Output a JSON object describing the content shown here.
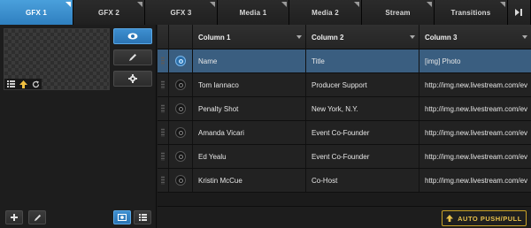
{
  "tabs": [
    {
      "label": "GFX 1",
      "active": true
    },
    {
      "label": "GFX 2",
      "active": false
    },
    {
      "label": "GFX 3",
      "active": false
    },
    {
      "label": "Media 1",
      "active": false
    },
    {
      "label": "Media 2",
      "active": false
    },
    {
      "label": "Stream",
      "active": false
    },
    {
      "label": "Transitions",
      "active": false
    }
  ],
  "tab_overflow_icon": "skip-next-icon",
  "preview": {
    "icons": [
      "list-icon",
      "arrow-up-icon",
      "refresh-icon"
    ]
  },
  "side_buttons": [
    {
      "icon": "eye-icon",
      "active": true
    },
    {
      "icon": "pencil-icon",
      "active": false
    },
    {
      "icon": "gear-icon",
      "active": false
    }
  ],
  "bottom_left_buttons": [
    {
      "icon": "plus-icon",
      "active": false
    },
    {
      "icon": "pencil-icon",
      "active": false
    },
    {
      "icon": "image-view-icon",
      "active": true
    },
    {
      "icon": "list-view-icon",
      "active": false
    }
  ],
  "table": {
    "columns": [
      "Column 1",
      "Column 2",
      "Column 3"
    ],
    "rows": [
      {
        "c1": "Name",
        "c2": "Title",
        "c3": "[img] Photo",
        "selected": true
      },
      {
        "c1": "Tom Iannaco",
        "c2": "Producer Support",
        "c3": "http://img.new.livestream.com/ev",
        "selected": false
      },
      {
        "c1": "Penalty Shot",
        "c2": "New York, N.Y.",
        "c3": "http://img.new.livestream.com/ev",
        "selected": false
      },
      {
        "c1": "Amanda Vicari",
        "c2": "Event Co-Founder",
        "c3": "http://img.new.livestream.com/ev",
        "selected": false
      },
      {
        "c1": "Ed Yealu",
        "c2": "Event Co-Founder",
        "c3": "http://img.new.livestream.com/ev",
        "selected": false
      },
      {
        "c1": "Kristin McCue",
        "c2": "Co-Host",
        "c3": "http://img.new.livestream.com/ev",
        "selected": false
      }
    ]
  },
  "auto_push_pull": {
    "label": "AUTO PUSH/PULL",
    "icon": "arrow-up-icon"
  },
  "colors": {
    "accent": "#3a8fd2",
    "selected_row": "#3a5e80",
    "warning": "#e8c14a"
  }
}
